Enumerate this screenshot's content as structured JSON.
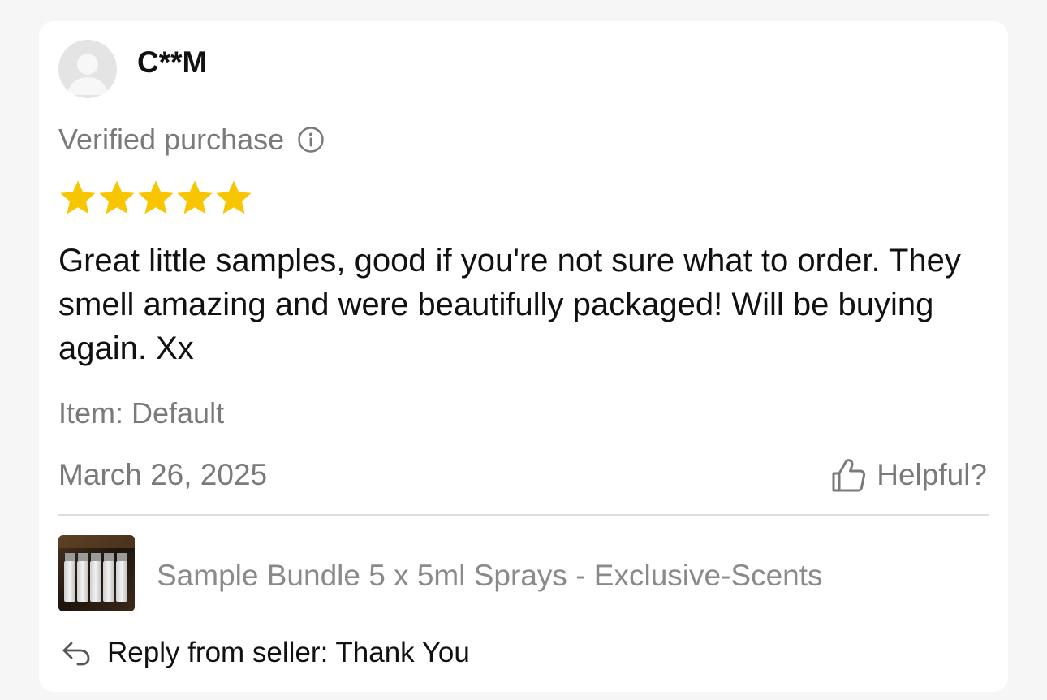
{
  "review": {
    "username": "C**M",
    "verified_label": "Verified purchase",
    "rating": 5,
    "rating_max": 5,
    "star_color": "#f7c600",
    "text": "Great little samples, good if you're not sure what to order. They smell amazing and were beautifully packaged! Will be buying again. Xx",
    "item_variant": "Item: Default",
    "date": "March 26, 2025",
    "helpful_label": "Helpful?"
  },
  "product": {
    "title": "Sample Bundle 5 x 5ml Sprays - Exclusive-Scents"
  },
  "seller_reply": {
    "text": "Reply from seller: Thank You"
  },
  "icons": {
    "avatar": "user-avatar-icon",
    "info": "info-icon",
    "star": "star-icon",
    "thumbs_up": "thumbs-up-icon",
    "reply": "reply-arrow-icon"
  }
}
